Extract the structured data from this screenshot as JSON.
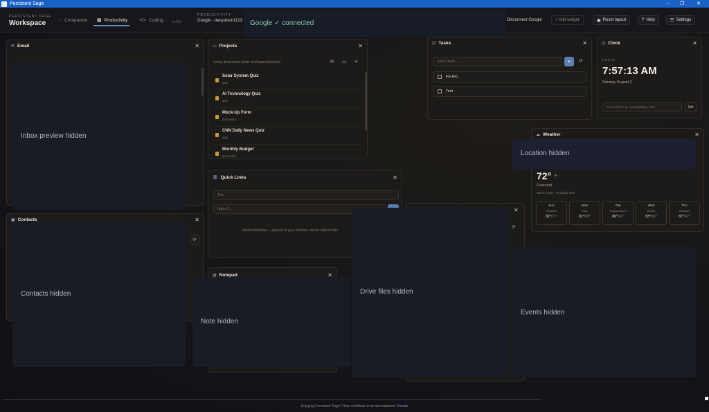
{
  "window": {
    "title": "Persistent Sage",
    "min": "–",
    "max": "❐",
    "close": "✕"
  },
  "brand": {
    "sub": "PERSISTENT SAGE",
    "title": "Workspace"
  },
  "nav": {
    "tabs": [
      {
        "label": "Companion",
        "icon": "◌"
      },
      {
        "label": "Productivity",
        "icon": "▦"
      },
      {
        "label": "Coding",
        "icon": "</>"
      }
    ],
    "active": "Productivity",
    "version": "v1.0.0"
  },
  "productivity": {
    "sub": "PRODUCTIVITY",
    "account": "Google - danyalson1123"
  },
  "google_status": "Google ✓ connected",
  "toolbar": {
    "disconnect": "Disconnect Google",
    "add_widget": "+ Add widget",
    "reset": "Reset layout",
    "help": "Help",
    "settings": "Settings"
  },
  "email": {
    "title": "Email",
    "mask": "Inbox preview hidden"
  },
  "projects": {
    "title": "Projects",
    "hint": "Living documents under workspace/projects",
    "items": [
      {
        "name": "Solar System Quiz",
        "kind": "quiz"
      },
      {
        "name": "AI Technology Quiz",
        "kind": "quiz"
      },
      {
        "name": "Mock-Up Form",
        "kind": "document"
      },
      {
        "name": "CNN Daily News Quiz",
        "kind": "quiz"
      },
      {
        "name": "Monthly Budget",
        "kind": "document"
      }
    ]
  },
  "tasks": {
    "title": "Tasks",
    "placeholder": "Add a task...",
    "add": "+",
    "items": [
      "Fix A/C",
      "Test"
    ]
  },
  "clock": {
    "title": "Clock",
    "label": "LOCAL",
    "time": "7:57:13 AM",
    "date": "Sunday, August 2",
    "second_placeholder": "Second TZ e.g. America/New_York",
    "set": "Set"
  },
  "weather": {
    "title": "Weather",
    "mask": "Location hidden",
    "temp": "72°",
    "unit": "F",
    "condition": "Overcast",
    "details": "Wind 3 mph · Humidity 92%",
    "forecast": [
      {
        "day": "Sun",
        "cond": "Showers",
        "hi": "82°",
        "lo": "/71°"
      },
      {
        "day": "Mon",
        "cond": "Rain",
        "hi": "81°",
        "lo": "/68°"
      },
      {
        "day": "Tue",
        "cond": "Thunderstorm",
        "hi": "86°",
        "lo": "/60°"
      },
      {
        "day": "Wed",
        "cond": "Drizzle",
        "hi": "83°",
        "lo": "/66°"
      },
      {
        "day": "Thu",
        "cond": "Showers",
        "hi": "87°",
        "lo": "/67°"
      }
    ]
  },
  "quicklinks": {
    "title": "Quick Links",
    "title_placeholder": "Title",
    "url_placeholder": "https://...",
    "hint": "Add bookmarks — opened in your browser, stored only on this"
  },
  "contacts": {
    "title": "Contacts",
    "mask": "Contacts hidden"
  },
  "notepad": {
    "title": "Notepad",
    "mask": "Note hidden"
  },
  "drive": {
    "mask": "Drive files hidden"
  },
  "events": {
    "mask": "Events hidden"
  },
  "footer": {
    "text": "Enjoying Persistent Sage? Help contribute to its development.",
    "donate": "Donate"
  },
  "colors": {
    "accent": "#6b8fc0",
    "connected": "#8ec6a2",
    "doc": "#c99a3a"
  }
}
